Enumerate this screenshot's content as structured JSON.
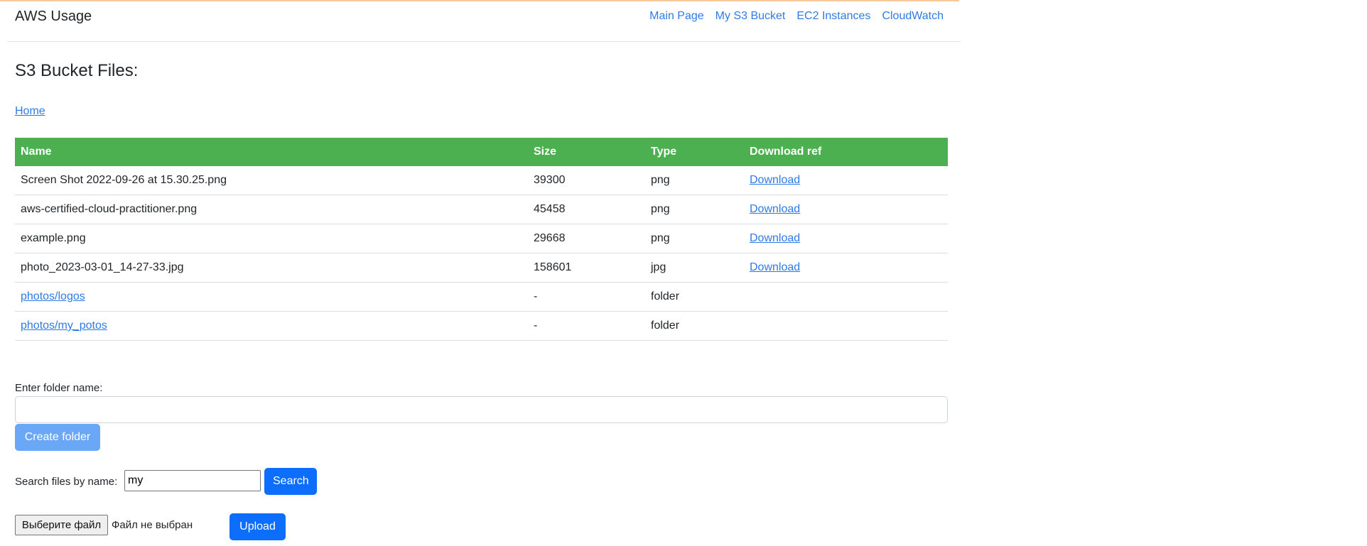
{
  "navbar": {
    "brand": "AWS Usage",
    "links": [
      "Main Page",
      "My S3 Bucket",
      "EC2 Instances",
      "CloudWatch"
    ]
  },
  "page": {
    "title": "S3 Bucket Files:",
    "breadcrumb": "Home"
  },
  "table": {
    "headers": [
      "Name",
      "Size",
      "Type",
      "Download ref"
    ],
    "rows": [
      {
        "name": "Screen Shot 2022-09-26 at 15.30.25.png",
        "size": "39300",
        "type": "png",
        "download": "Download",
        "is_link": false
      },
      {
        "name": "aws-certified-cloud-practitioner.png",
        "size": "45458",
        "type": "png",
        "download": "Download",
        "is_link": false
      },
      {
        "name": "example.png",
        "size": "29668",
        "type": "png",
        "download": "Download",
        "is_link": false
      },
      {
        "name": "photo_2023-03-01_14-27-33.jpg",
        "size": "158601",
        "type": "jpg",
        "download": "Download",
        "is_link": false
      },
      {
        "name": "photos/logos",
        "size": "-",
        "type": "folder",
        "download": "",
        "is_link": true
      },
      {
        "name": "photos/my_potos",
        "size": "-",
        "type": "folder",
        "download": "",
        "is_link": true
      }
    ]
  },
  "create_folder": {
    "label": "Enter folder name:",
    "value": "",
    "button": "Create folder"
  },
  "search": {
    "label": "Search files by name:",
    "value": "my",
    "button": "Search"
  },
  "upload": {
    "choose_button": "Выберите файл",
    "status": "Файл не выбран",
    "button": "Upload"
  },
  "colors": {
    "table_header": "#4caf50",
    "link": "#2f7be5",
    "primary": "#0d6efd",
    "primary_disabled": "#6aa8f7"
  }
}
